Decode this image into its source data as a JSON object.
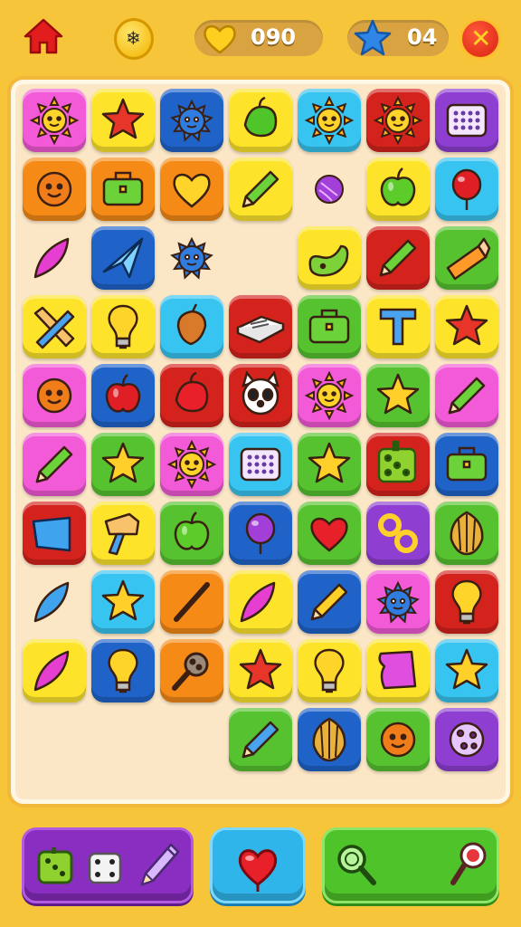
{
  "topbar": {
    "lives_value": "090",
    "stars_value": "04",
    "coin_symbol": "❄"
  },
  "colors": {
    "background": "#f7c53a",
    "board": "#fbe6c6",
    "tile_magenta": "#f25ad7",
    "tile_yellow": "#fde42b",
    "tile_blue": "#1f63c9",
    "tile_cyan": "#38c4f0",
    "tile_red": "#d3231c",
    "tile_purple": "#8e3fd1",
    "tile_orange": "#f58a16",
    "tile_green": "#56c22f"
  },
  "board": {
    "tiles": [
      {
        "row": 1,
        "col": 1,
        "color": "magenta",
        "icon": "sun"
      },
      {
        "row": 1,
        "col": 2,
        "color": "yellow",
        "icon": "star"
      },
      {
        "row": 1,
        "col": 3,
        "color": "blue",
        "icon": "spiky-creature"
      },
      {
        "row": 1,
        "col": 4,
        "color": "yellow",
        "icon": "pepper"
      },
      {
        "row": 1,
        "col": 5,
        "color": "cyan",
        "icon": "sun"
      },
      {
        "row": 1,
        "col": 6,
        "color": "red",
        "icon": "sun"
      },
      {
        "row": 1,
        "col": 7,
        "color": "purple",
        "icon": "tablet"
      },
      {
        "row": 2,
        "col": 1,
        "color": "orange",
        "icon": "smiley"
      },
      {
        "row": 2,
        "col": 2,
        "color": "orange",
        "icon": "briefcase"
      },
      {
        "row": 2,
        "col": 3,
        "color": "orange",
        "icon": "heart"
      },
      {
        "row": 2,
        "col": 4,
        "color": "yellow",
        "icon": "pencil"
      },
      {
        "row": 2,
        "col": 5,
        "color": "none",
        "icon": "ball"
      },
      {
        "row": 2,
        "col": 6,
        "color": "yellow",
        "icon": "apple"
      },
      {
        "row": 2,
        "col": 7,
        "color": "cyan",
        "icon": "balloon"
      },
      {
        "row": 3,
        "col": 1,
        "color": "none",
        "icon": "leaf"
      },
      {
        "row": 3,
        "col": 2,
        "color": "blue",
        "icon": "paper-plane"
      },
      {
        "row": 3,
        "col": 3,
        "color": "none",
        "icon": "spiky-creature"
      },
      {
        "row": 3,
        "col": 5,
        "color": "yellow",
        "icon": "pickle"
      },
      {
        "row": 3,
        "col": 6,
        "color": "red",
        "icon": "pencil"
      },
      {
        "row": 3,
        "col": 7,
        "color": "green",
        "icon": "crayon"
      },
      {
        "row": 4,
        "col": 1,
        "color": "yellow",
        "icon": "pencil-cross"
      },
      {
        "row": 4,
        "col": 2,
        "color": "yellow",
        "icon": "lightbulb"
      },
      {
        "row": 4,
        "col": 3,
        "color": "cyan",
        "icon": "acorn"
      },
      {
        "row": 4,
        "col": 4,
        "color": "red",
        "icon": "book"
      },
      {
        "row": 4,
        "col": 5,
        "color": "green",
        "icon": "briefcase"
      },
      {
        "row": 4,
        "col": 6,
        "color": "yellow",
        "icon": "t-letter"
      },
      {
        "row": 4,
        "col": 7,
        "color": "yellow",
        "icon": "star"
      },
      {
        "row": 5,
        "col": 1,
        "color": "magenta",
        "icon": "smiley"
      },
      {
        "row": 5,
        "col": 2,
        "color": "blue",
        "icon": "apple"
      },
      {
        "row": 5,
        "col": 3,
        "color": "red",
        "icon": "pepper"
      },
      {
        "row": 5,
        "col": 4,
        "color": "red",
        "icon": "panda"
      },
      {
        "row": 5,
        "col": 5,
        "color": "magenta",
        "icon": "sun"
      },
      {
        "row": 5,
        "col": 6,
        "color": "green",
        "icon": "star"
      },
      {
        "row": 5,
        "col": 7,
        "color": "magenta",
        "icon": "pencil"
      },
      {
        "row": 6,
        "col": 1,
        "color": "magenta",
        "icon": "pencil"
      },
      {
        "row": 6,
        "col": 2,
        "color": "green",
        "icon": "star"
      },
      {
        "row": 6,
        "col": 3,
        "color": "magenta",
        "icon": "sun"
      },
      {
        "row": 6,
        "col": 4,
        "color": "cyan",
        "icon": "tablet"
      },
      {
        "row": 6,
        "col": 5,
        "color": "green",
        "icon": "star"
      },
      {
        "row": 6,
        "col": 6,
        "color": "red",
        "icon": "dice"
      },
      {
        "row": 6,
        "col": 7,
        "color": "blue",
        "icon": "briefcase"
      },
      {
        "row": 7,
        "col": 1,
        "color": "red",
        "icon": "cup"
      },
      {
        "row": 7,
        "col": 2,
        "color": "yellow",
        "icon": "hammer"
      },
      {
        "row": 7,
        "col": 3,
        "color": "green",
        "icon": "apple"
      },
      {
        "row": 7,
        "col": 4,
        "color": "blue",
        "icon": "balloon"
      },
      {
        "row": 7,
        "col": 5,
        "color": "green",
        "icon": "heart"
      },
      {
        "row": 7,
        "col": 6,
        "color": "purple",
        "icon": "rings"
      },
      {
        "row": 7,
        "col": 7,
        "color": "green",
        "icon": "shell"
      },
      {
        "row": 8,
        "col": 1,
        "color": "none",
        "icon": "leaf"
      },
      {
        "row": 8,
        "col": 2,
        "color": "cyan",
        "icon": "star"
      },
      {
        "row": 8,
        "col": 3,
        "color": "orange",
        "icon": "stick"
      },
      {
        "row": 8,
        "col": 4,
        "color": "yellow",
        "icon": "leaf"
      },
      {
        "row": 8,
        "col": 5,
        "color": "blue",
        "icon": "pencil"
      },
      {
        "row": 8,
        "col": 6,
        "color": "magenta",
        "icon": "spiky-creature"
      },
      {
        "row": 8,
        "col": 7,
        "color": "red",
        "icon": "lightbulb"
      },
      {
        "row": 9,
        "col": 1,
        "color": "yellow",
        "icon": "leaf"
      },
      {
        "row": 9,
        "col": 2,
        "color": "blue",
        "icon": "lightbulb"
      },
      {
        "row": 9,
        "col": 3,
        "color": "orange",
        "icon": "magnifier"
      },
      {
        "row": 9,
        "col": 4,
        "color": "yellow",
        "icon": "star"
      },
      {
        "row": 9,
        "col": 5,
        "color": "yellow",
        "icon": "lightbulb"
      },
      {
        "row": 9,
        "col": 6,
        "color": "yellow",
        "icon": "cloth"
      },
      {
        "row": 9,
        "col": 7,
        "color": "cyan",
        "icon": "star"
      },
      {
        "row": 10,
        "col": 4,
        "color": "green",
        "icon": "pencil"
      },
      {
        "row": 10,
        "col": 5,
        "color": "blue",
        "icon": "shell"
      },
      {
        "row": 10,
        "col": 6,
        "color": "green",
        "icon": "smiley"
      },
      {
        "row": 10,
        "col": 7,
        "color": "purple",
        "icon": "cookie"
      }
    ]
  },
  "bottombar": {
    "tray_icons": [
      "dice",
      "dice",
      "pencil"
    ],
    "heart_button_icon": "heart",
    "tool_icons": [
      "magnifier",
      "magnifier"
    ]
  }
}
